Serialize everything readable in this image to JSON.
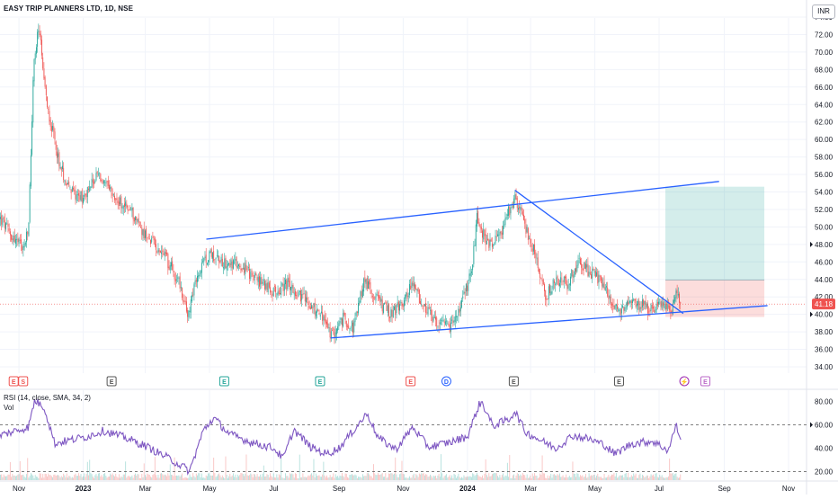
{
  "header": {
    "title": "EASY TRIP PLANNERS LTD, 1D, NSE",
    "currency": "INR"
  },
  "indicators": {
    "rsi_label": "RSI (14, close, SMA, 34, 2)",
    "vol_label": "Vol"
  },
  "colors": {
    "up": "#26a69a",
    "down": "#ef5350",
    "trendline": "#2962ff",
    "rsi": "#7e57c2",
    "target_zone": "#26a69a",
    "stop_zone": "#ef5350",
    "price_tag": "#ef5350"
  },
  "chart_data": [
    {
      "type": "candlestick",
      "title": "EASY TRIP PLANNERS LTD, 1D, NSE",
      "currency": "INR",
      "ylim": [
        34,
        75.5
      ],
      "yticks": [
        "34.00",
        "36.00",
        "38.00",
        "40.00",
        "42.00",
        "44.00",
        "46.00",
        "48.00",
        "50.00",
        "52.00",
        "54.00",
        "56.00",
        "58.00",
        "60.00",
        "62.00",
        "64.00",
        "66.00",
        "68.00",
        "70.00",
        "72.00",
        "74.00"
      ],
      "xticks": [
        {
          "label": "Nov",
          "bold": false
        },
        {
          "label": "2023",
          "bold": true
        },
        {
          "label": "Mar",
          "bold": false
        },
        {
          "label": "May",
          "bold": false
        },
        {
          "label": "Jul",
          "bold": false
        },
        {
          "label": "Sep",
          "bold": false
        },
        {
          "label": "Nov",
          "bold": false
        },
        {
          "label": "2024",
          "bold": true
        },
        {
          "label": "Mar",
          "bold": false
        },
        {
          "label": "May",
          "bold": false
        },
        {
          "label": "Jul",
          "bold": false
        },
        {
          "label": "Sep",
          "bold": false
        },
        {
          "label": "Nov",
          "bold": false
        }
      ],
      "last_price": "41.18",
      "price_path": [
        [
          "2022-10-14",
          51
        ],
        [
          "2022-10-25",
          49
        ],
        [
          "2022-11-05",
          47.5
        ],
        [
          "2022-11-10",
          49.5
        ],
        [
          "2022-11-15",
          68.5
        ],
        [
          "2022-11-20",
          73
        ],
        [
          "2022-11-25",
          66
        ],
        [
          "2022-12-01",
          62
        ],
        [
          "2022-12-10",
          57
        ],
        [
          "2022-12-20",
          54
        ],
        [
          "2023-01-01",
          53.5
        ],
        [
          "2023-01-15",
          56
        ],
        [
          "2023-02-01",
          53
        ],
        [
          "2023-02-15",
          52
        ],
        [
          "2023-03-01",
          49
        ],
        [
          "2023-03-15",
          47.5
        ],
        [
          "2023-04-01",
          44
        ],
        [
          "2023-04-10",
          40
        ],
        [
          "2023-04-20",
          44.5
        ],
        [
          "2023-05-01",
          47
        ],
        [
          "2023-05-15",
          46
        ],
        [
          "2023-06-01",
          45.5
        ],
        [
          "2023-06-15",
          44
        ],
        [
          "2023-07-01",
          42.5
        ],
        [
          "2023-07-15",
          43.5
        ],
        [
          "2023-08-01",
          41.5
        ],
        [
          "2023-08-15",
          40
        ],
        [
          "2023-08-25",
          37.5
        ],
        [
          "2023-09-05",
          39.5
        ],
        [
          "2023-09-15",
          38.5
        ],
        [
          "2023-09-25",
          44
        ],
        [
          "2023-10-05",
          42
        ],
        [
          "2023-10-20",
          40
        ],
        [
          "2023-11-01",
          41.5
        ],
        [
          "2023-11-10",
          43.5
        ],
        [
          "2023-11-20",
          41
        ],
        [
          "2023-12-01",
          39
        ],
        [
          "2023-12-15",
          38.5
        ],
        [
          "2023-12-25",
          40.5
        ],
        [
          "2024-01-05",
          45
        ],
        [
          "2024-01-10",
          51
        ],
        [
          "2024-01-20",
          48
        ],
        [
          "2024-02-01",
          49
        ],
        [
          "2024-02-10",
          52
        ],
        [
          "2024-02-15",
          53.5
        ],
        [
          "2024-02-25",
          50
        ],
        [
          "2024-03-05",
          47
        ],
        [
          "2024-03-15",
          42
        ],
        [
          "2024-03-25",
          44
        ],
        [
          "2024-04-05",
          43.5
        ],
        [
          "2024-04-15",
          46
        ],
        [
          "2024-04-25",
          45
        ],
        [
          "2024-05-05",
          44
        ],
        [
          "2024-05-15",
          42
        ],
        [
          "2024-05-25",
          40
        ],
        [
          "2024-06-05",
          41.5
        ],
        [
          "2024-06-15",
          41
        ],
        [
          "2024-06-25",
          40.5
        ],
        [
          "2024-07-05",
          41
        ],
        [
          "2024-07-12",
          40.2
        ],
        [
          "2024-07-17",
          43
        ],
        [
          "2024-07-22",
          41.18
        ]
      ],
      "drawings": {
        "upper_channel": [
          [
            "2023-04-28",
            48.6
          ],
          [
            "2024-08-27",
            55.2
          ]
        ],
        "lower_channel": [
          [
            "2023-08-24",
            37.3
          ],
          [
            "2024-10-12",
            41.0
          ]
        ],
        "descending_line": [
          [
            "2024-02-15",
            54.2
          ],
          [
            "2024-07-24",
            40.1
          ]
        ],
        "long_position": {
          "start": "2024-07-07",
          "end": "2024-10-09",
          "entry": 43.9,
          "target": 54.6,
          "stop": 39.7
        }
      }
    },
    {
      "type": "line",
      "name": "RSI (14, close, SMA, 34, 2)",
      "ylim": [
        16,
        84
      ],
      "yticks": [
        "20.00",
        "40.00",
        "60.00",
        "80.00"
      ],
      "levels": [
        20,
        60
      ],
      "value_marker": 60,
      "path": [
        [
          "2022-10-14",
          51
        ],
        [
          "2022-11-10",
          58
        ],
        [
          "2022-11-16",
          81
        ],
        [
          "2022-11-25",
          75
        ],
        [
          "2022-12-05",
          44
        ],
        [
          "2022-12-20",
          47
        ],
        [
          "2023-01-05",
          50
        ],
        [
          "2023-01-20",
          55
        ],
        [
          "2023-02-10",
          49
        ],
        [
          "2023-03-01",
          42
        ],
        [
          "2023-03-20",
          33
        ],
        [
          "2023-04-08",
          23
        ],
        [
          "2023-04-12",
          20
        ],
        [
          "2023-04-25",
          55
        ],
        [
          "2023-05-05",
          66
        ],
        [
          "2023-05-20",
          52
        ],
        [
          "2023-06-10",
          45
        ],
        [
          "2023-07-01",
          40
        ],
        [
          "2023-07-10",
          31
        ],
        [
          "2023-07-20",
          56
        ],
        [
          "2023-08-05",
          41
        ],
        [
          "2023-08-20",
          35
        ],
        [
          "2023-09-01",
          40
        ],
        [
          "2023-09-20",
          61
        ],
        [
          "2023-09-28",
          70
        ],
        [
          "2023-10-08",
          49
        ],
        [
          "2023-10-25",
          39
        ],
        [
          "2023-11-10",
          58
        ],
        [
          "2023-11-25",
          41
        ],
        [
          "2023-12-15",
          45
        ],
        [
          "2024-01-01",
          50
        ],
        [
          "2024-01-12",
          77
        ],
        [
          "2024-01-15",
          79
        ],
        [
          "2024-01-25",
          59
        ],
        [
          "2024-02-10",
          65
        ],
        [
          "2024-02-15",
          72
        ],
        [
          "2024-02-25",
          54
        ],
        [
          "2024-03-10",
          47
        ],
        [
          "2024-03-25",
          40
        ],
        [
          "2024-04-10",
          51
        ],
        [
          "2024-04-25",
          48
        ],
        [
          "2024-05-10",
          43
        ],
        [
          "2024-05-20",
          35
        ],
        [
          "2024-06-05",
          44
        ],
        [
          "2024-06-25",
          46
        ],
        [
          "2024-07-10",
          38
        ],
        [
          "2024-07-17",
          60
        ],
        [
          "2024-07-22",
          47
        ]
      ]
    }
  ],
  "events": [
    {
      "label": "E",
      "date": "2022-10-27",
      "type": "earnings-red"
    },
    {
      "label": "S",
      "date": "2022-11-05",
      "type": "split-red"
    },
    {
      "label": "E",
      "date": "2023-01-28",
      "type": "earnings-gray"
    },
    {
      "label": "E",
      "date": "2023-05-15",
      "type": "earnings-green"
    },
    {
      "label": "E",
      "date": "2023-08-14",
      "type": "earnings-green"
    },
    {
      "label": "E",
      "date": "2023-11-08",
      "type": "earnings-red"
    },
    {
      "label": "D",
      "date": "2023-12-12",
      "type": "dividend-blue"
    },
    {
      "label": "E",
      "date": "2024-02-14",
      "type": "earnings-gray"
    },
    {
      "label": "E",
      "date": "2024-05-24",
      "type": "earnings-gray"
    },
    {
      "label": "⚡",
      "date": "2024-07-25",
      "type": "flash-purple"
    },
    {
      "label": "E",
      "date": "2024-08-14",
      "type": "earnings-purple"
    }
  ]
}
